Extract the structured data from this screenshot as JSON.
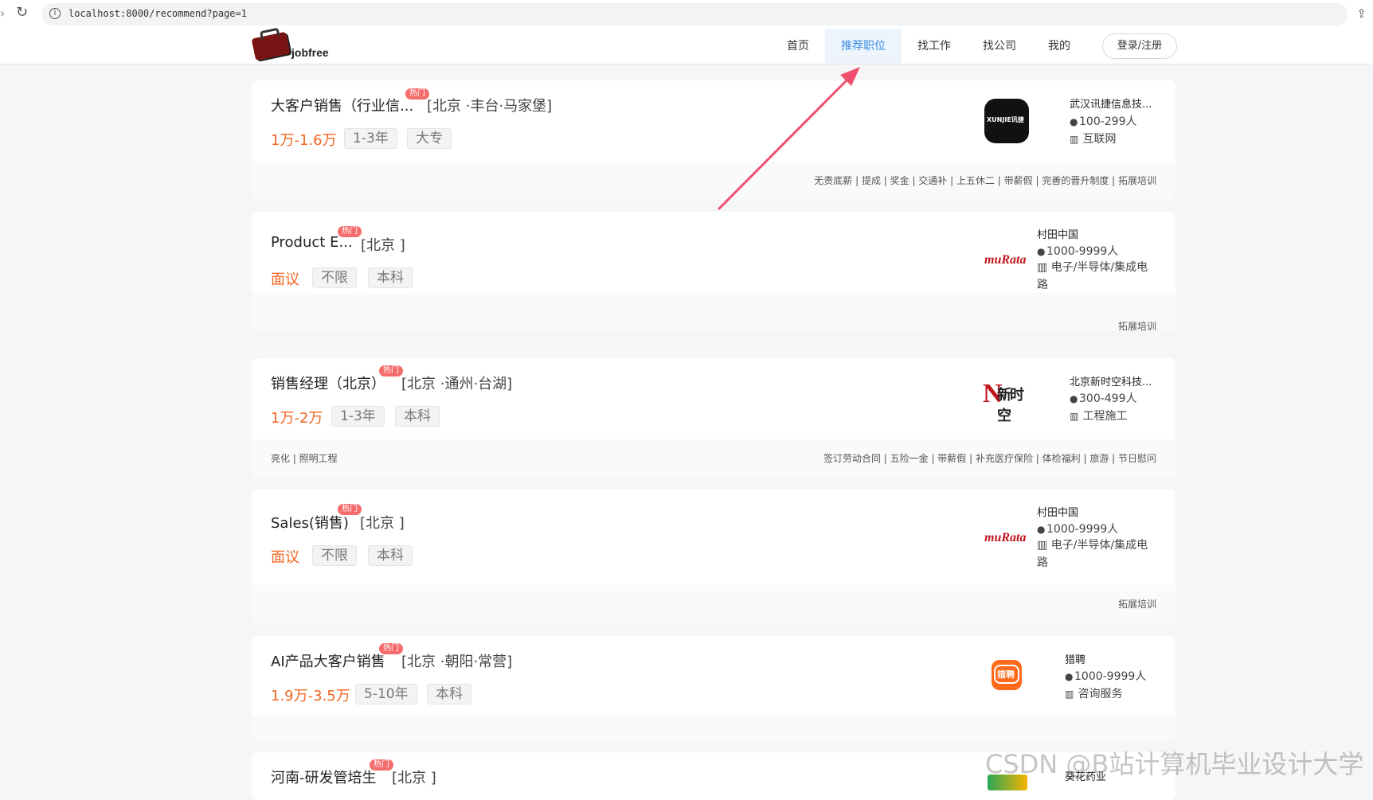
{
  "browser": {
    "url": "localhost:8000/recommend?page=1"
  },
  "nav": {
    "logo_text": "jobfree",
    "items": [
      "首页",
      "推荐职位",
      "找工作",
      "找公司",
      "我的"
    ],
    "login": "登录/注册"
  },
  "hot_label": "热门",
  "jobs": [
    {
      "title": "大客户销售（行业信...",
      "area": "[北京 ·丰台·马家堡]",
      "salary": "1万-1.6万",
      "exp": "1-3年",
      "edu": "大专",
      "company": "武汉讯捷信息技...",
      "size": "100-299人",
      "industry": "互联网",
      "welfare": "无责底薪 | 提成 | 奖金 | 交通补 | 上五休二 | 带薪假 | 完善的晋升制度 | 拓展培训",
      "skills": ""
    },
    {
      "title": "Product E...",
      "area": "[北京 ]",
      "salary": "面议",
      "exp": "不限",
      "edu": "本科",
      "company": "村田中国",
      "size": "1000-9999人",
      "industry": "电子/半导体/集成电路",
      "welfare": "拓展培训",
      "skills": ""
    },
    {
      "title": "销售经理（北京）",
      "area": "[北京 ·通州·台湖]",
      "salary": "1万-2万",
      "exp": "1-3年",
      "edu": "本科",
      "company": "北京新时空科技...",
      "size": "300-499人",
      "industry": "工程施工",
      "welfare": "签订劳动合同 | 五险一金 | 带薪假 | 补充医疗保险 | 体检福利 | 旅游 | 节日慰问",
      "skills": "亮化 | 照明工程"
    },
    {
      "title": "Sales(销售)",
      "area": "[北京 ]",
      "salary": "面议",
      "exp": "不限",
      "edu": "本科",
      "company": "村田中国",
      "size": "1000-9999人",
      "industry": "电子/半导体/集成电路",
      "welfare": "拓展培训",
      "skills": ""
    },
    {
      "title": "AI产品大客户销售",
      "area": "[北京 ·朝阳·常营]",
      "salary": "1.9万-3.5万",
      "exp": "5-10年",
      "edu": "本科",
      "company": "猎聘",
      "size": "1000-9999人",
      "industry": "咨询服务",
      "welfare": "",
      "skills": ""
    },
    {
      "title": "河南-研发管培生",
      "area": "[北京 ]",
      "company": "葵花药业"
    }
  ],
  "logos": {
    "xunjie": "XUNJIE讯捷",
    "murata": "muRata",
    "xinshikong": "新时空",
    "liepin": "猎聘"
  },
  "watermark": "CSDN @B站计算机毕业设计大学",
  "colors": {
    "accent": "#3a8ee6",
    "salary": "#f26522",
    "hot": "#f56c6c"
  }
}
